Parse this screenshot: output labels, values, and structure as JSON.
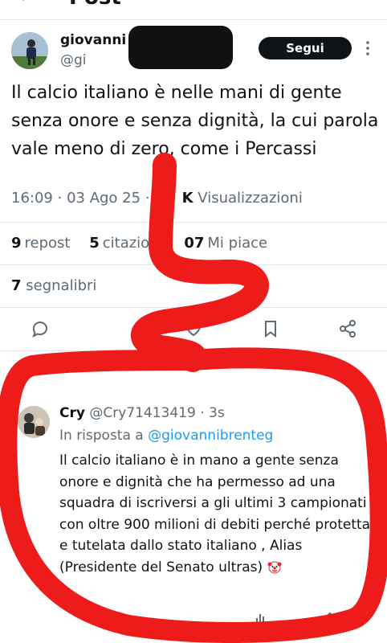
{
  "header": {
    "title": "Post"
  },
  "author": {
    "name": "giovanni",
    "handle": "@gi",
    "follow_label": "Segui"
  },
  "tweet": {
    "text": "Il calcio italiano è nelle mani di gente senza onore e senza dignità, la cui parola vale meno di zero, come i Percassi",
    "time": "16:09",
    "date": "03 Ago 25",
    "views_partial": "K",
    "views_label": "Visualizzazioni"
  },
  "stats": {
    "reposts_count": "9",
    "reposts_label": "repost",
    "quotes_count": "5",
    "quotes_label": "citazior",
    "likes_count": "07",
    "likes_label": "Mi piace",
    "bookmarks_count": "7",
    "bookmarks_label": "segnalibri"
  },
  "reply": {
    "name": "Cry",
    "handle": "@Cry71413419",
    "age": "3s",
    "in_reply_prefix": "In risposta a",
    "in_reply_to": "@giovannibrenteg",
    "text": "Il calcio italiano è in mano a gente senza onore e dignità che ha permesso ad una squadra di iscriversi a gli ultimi 3 campionati con oltre 900 milioni di debiti perché protetta e tutelata dallo stato italiano , Alias (Presidente del Senato ultras)"
  },
  "annotation_color": "#ee1b1b"
}
